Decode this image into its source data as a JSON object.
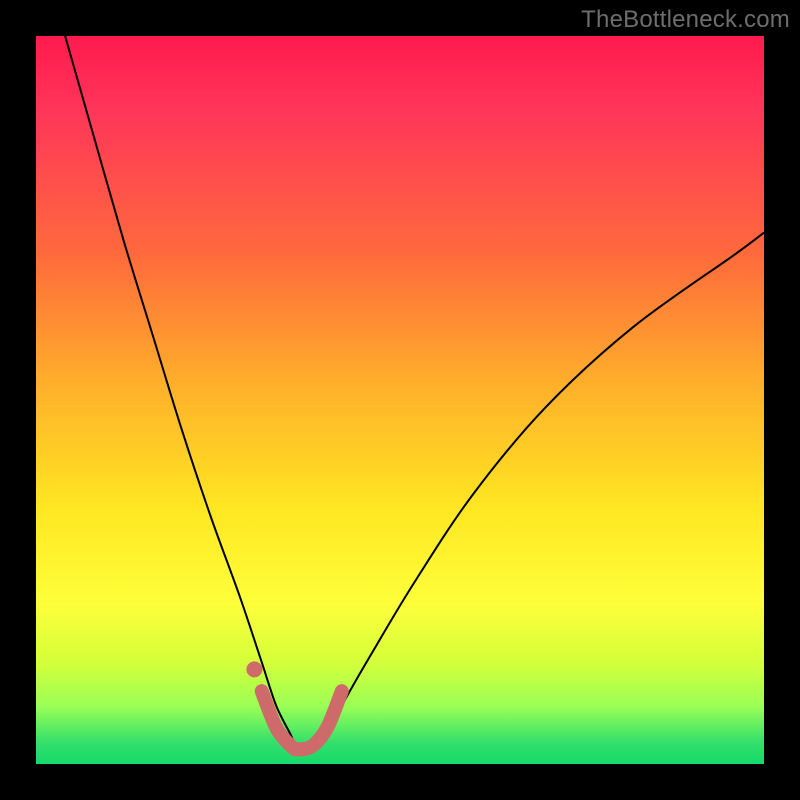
{
  "watermark": "TheBottleneck.com",
  "chart_data": {
    "type": "line",
    "title": "",
    "xlabel": "",
    "ylabel": "",
    "xlim": [
      0,
      100
    ],
    "ylim": [
      0,
      100
    ],
    "grid": false,
    "legend": false,
    "series": [
      {
        "name": "bottleneck-curve",
        "x": [
          4,
          8,
          12,
          16,
          20,
          24,
          28,
          31,
          33,
          35,
          36,
          38,
          40,
          42,
          46,
          52,
          60,
          70,
          82,
          96,
          100
        ],
        "y": [
          100,
          86,
          72,
          59,
          46,
          34,
          23,
          14,
          8,
          4,
          2,
          2,
          4,
          8,
          15,
          25,
          37,
          49,
          60,
          70,
          73
        ],
        "color": "#000000",
        "width": 2
      },
      {
        "name": "bottleneck-highlight",
        "x": [
          31,
          33,
          35,
          36,
          38,
          40,
          42
        ],
        "y": [
          10,
          5,
          2.5,
          2,
          2.5,
          5,
          10
        ],
        "color": "#cf6a6a",
        "width": 14
      }
    ],
    "markers": [
      {
        "name": "highlight-dot",
        "x": 30,
        "y": 13,
        "color": "#cf6a6a",
        "r": 8
      }
    ],
    "background_gradient": {
      "direction": "top-to-bottom",
      "stops": [
        {
          "pos": 0.0,
          "color": "#ff1a4d"
        },
        {
          "pos": 0.3,
          "color": "#ff6a3c"
        },
        {
          "pos": 0.65,
          "color": "#ffe722"
        },
        {
          "pos": 0.92,
          "color": "#9cff55"
        },
        {
          "pos": 1.0,
          "color": "#15d96a"
        }
      ]
    }
  }
}
